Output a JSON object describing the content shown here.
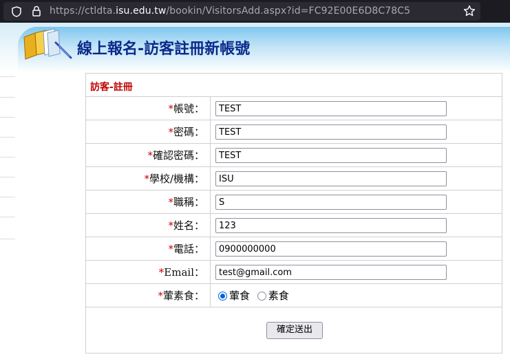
{
  "browser": {
    "url_prefix": "https://ctldta.",
    "url_domain": "isu.edu.tw",
    "url_path": "/bookin/VisitorsAdd.aspx?id=FC92E00E6D8C78C5"
  },
  "page": {
    "title": "線上報名-訪客註冊新帳號"
  },
  "form": {
    "header": "訪客-註冊",
    "required_mark": "*",
    "fields": [
      {
        "label": "帳號：",
        "value": "TEST"
      },
      {
        "label": "密碼：",
        "value": "TEST"
      },
      {
        "label": "確認密碼：",
        "value": "TEST"
      },
      {
        "label": "學校/機構：",
        "value": "ISU"
      },
      {
        "label": "職稱：",
        "value": "S"
      },
      {
        "label": "姓名：",
        "value": "123"
      },
      {
        "label": "電話：",
        "value": "0900000000"
      },
      {
        "label": "Email：",
        "value": "test@gmail.com"
      }
    ],
    "diet": {
      "label": "葷素食：",
      "options": [
        "葷食",
        "素食"
      ],
      "selected": "葷食"
    },
    "submit_label": "確定送出"
  }
}
